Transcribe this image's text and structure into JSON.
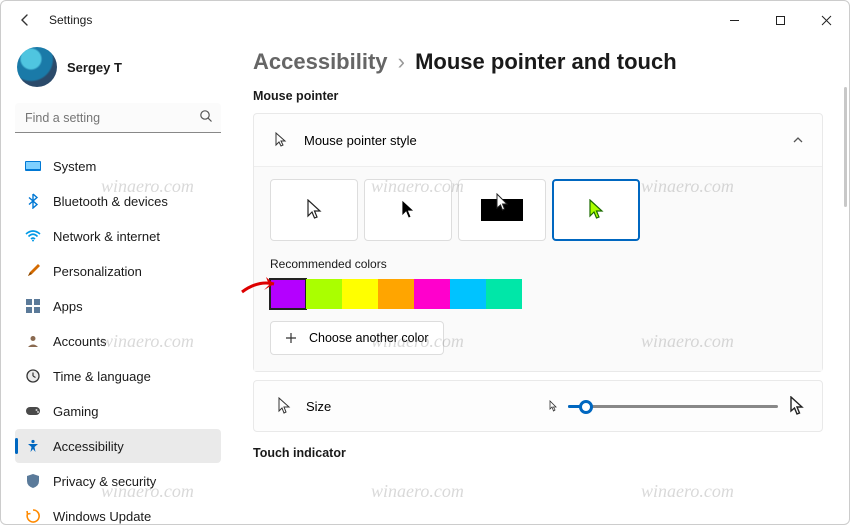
{
  "window": {
    "title": "Settings"
  },
  "profile": {
    "name": "Sergey T"
  },
  "search": {
    "placeholder": "Find a setting"
  },
  "sidebar": {
    "items": [
      {
        "label": "System",
        "icon": "system"
      },
      {
        "label": "Bluetooth & devices",
        "icon": "bluetooth"
      },
      {
        "label": "Network & internet",
        "icon": "wifi"
      },
      {
        "label": "Personalization",
        "icon": "brush"
      },
      {
        "label": "Apps",
        "icon": "apps"
      },
      {
        "label": "Accounts",
        "icon": "accounts"
      },
      {
        "label": "Time & language",
        "icon": "clock"
      },
      {
        "label": "Gaming",
        "icon": "gaming"
      },
      {
        "label": "Accessibility",
        "icon": "accessibility",
        "active": true
      },
      {
        "label": "Privacy & security",
        "icon": "privacy"
      },
      {
        "label": "Windows Update",
        "icon": "update"
      }
    ]
  },
  "breadcrumb": {
    "parent": "Accessibility",
    "current": "Mouse pointer and touch"
  },
  "pointer": {
    "section_label": "Mouse pointer",
    "style_label": "Mouse pointer style",
    "styles": [
      "white",
      "black",
      "inverted",
      "custom"
    ],
    "selected_style_index": 3,
    "rec_label": "Recommended colors",
    "colors": [
      "#b400ff",
      "#aaff00",
      "#ffff00",
      "#ffa500",
      "#ff00cc",
      "#00c3ff",
      "#00e7a8"
    ],
    "selected_color_index": 0,
    "choose_label": "Choose another color",
    "size_label": "Size",
    "size_value_pct": 8
  },
  "touch": {
    "section_label": "Touch indicator"
  },
  "watermark": "winaero.com"
}
